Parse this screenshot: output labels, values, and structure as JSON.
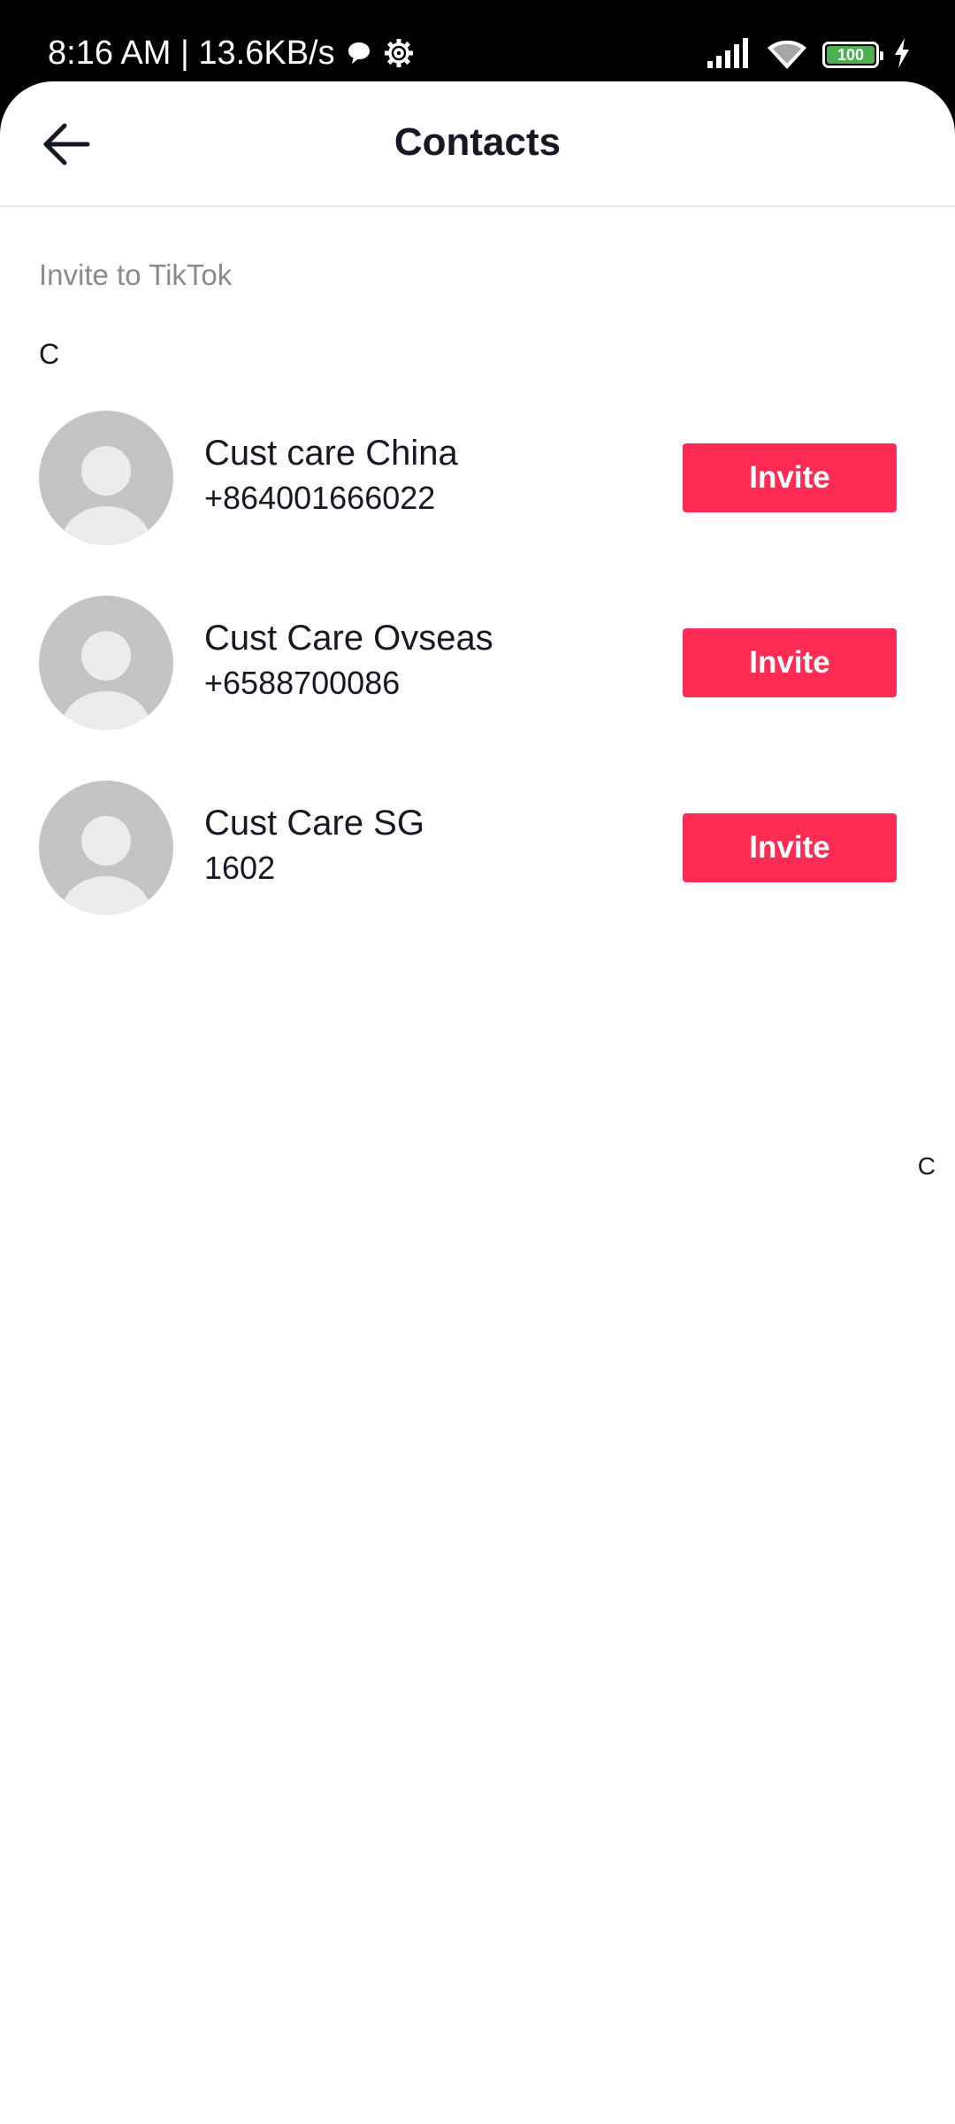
{
  "status_bar": {
    "time_speed": "8:16 AM | 13.6KB/s",
    "chat_icon": "chat-bubble-icon",
    "settings_icon": "gear-icon",
    "signal_icon": "signal-icon",
    "wifi_icon": "wifi-icon",
    "battery_level": "100",
    "battery_fraction": 1.0,
    "charging_icon": "charging-bolt-icon",
    "battery_color": "#4CAF50"
  },
  "header": {
    "back_icon": "arrow-left-icon",
    "title": "Contacts"
  },
  "section": {
    "label": "Invite to TikTok",
    "group_letter": "C"
  },
  "contacts": [
    {
      "name": "Cust care China",
      "phone": "+864001666022",
      "button": "Invite"
    },
    {
      "name": "Cust Care Ovseas",
      "phone": "+6588700086",
      "button": "Invite"
    },
    {
      "name": "Cust Care SG",
      "phone": "1602",
      "button": "Invite"
    }
  ],
  "index_bar": {
    "letters": [
      "C"
    ]
  },
  "colors": {
    "accent": "#fe2c55",
    "title_text": "#161823",
    "secondary_text": "#8a8b91",
    "avatar_bg": "#c4c4c4"
  }
}
